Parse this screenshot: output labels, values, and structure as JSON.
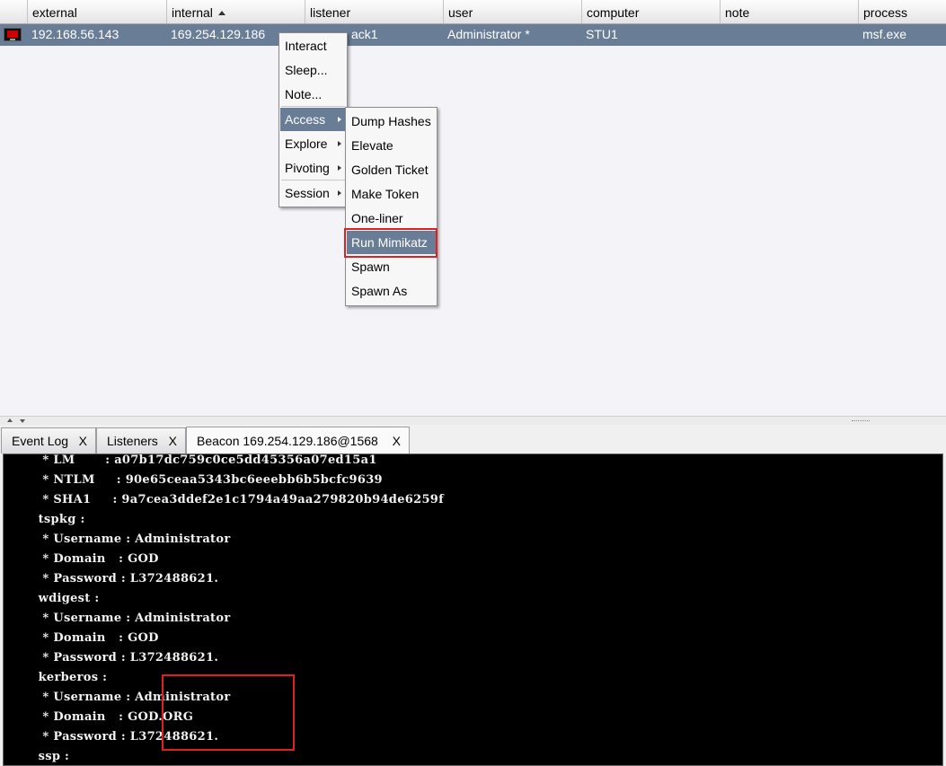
{
  "table": {
    "columns": [
      "external",
      "internal",
      "listener",
      "user",
      "computer",
      "note",
      "process"
    ],
    "sort_column": "internal",
    "row": {
      "icon": "windows-beacon-icon",
      "external": "192.168.56.143",
      "internal": "169.254.129.186",
      "listener": "ack1",
      "user": "Administrator *",
      "computer": "STU1",
      "note": "",
      "process": "msf.exe"
    }
  },
  "context_menu": {
    "items": [
      "Interact",
      "Sleep...",
      "Note...",
      "Access",
      "Explore",
      "Pivoting",
      "Session"
    ],
    "selected": "Access"
  },
  "access_submenu": {
    "items": [
      "Dump Hashes",
      "Elevate",
      "Golden Ticket",
      "Make Token",
      "One-liner",
      "Run Mimikatz",
      "Spawn",
      "Spawn As"
    ],
    "selected": "Run Mimikatz"
  },
  "tabs": [
    {
      "label": "Event Log",
      "close": "X"
    },
    {
      "label": "Listeners",
      "close": "X"
    },
    {
      "label": "Beacon 169.254.129.186@1568",
      "close": "X"
    }
  ],
  "console_lines": [
    "         * LM       : a07b17dc759c0ce5dd45356a07ed15a1",
    "         * NTLM     : 90e65ceaa5343bc6eeebb6b5bcfc9639",
    "         * SHA1     : 9a7cea3ddef2e1c1794a49aa279820b94de6259f",
    "        tspkg :",
    "         * Username : Administrator",
    "         * Domain   : GOD",
    "         * Password : L372488621.",
    "        wdigest :",
    "         * Username : Administrator",
    "         * Domain   : GOD",
    "         * Password : L372488621.",
    "        kerberos :",
    "         * Username : Administrator",
    "         * Domain   : GOD.ORG",
    "         * Password : L372488621.",
    "        ssp :"
  ],
  "colors": {
    "selection": "#6a7d96",
    "highlight_box": "#e02020",
    "console_bg": "#000000"
  }
}
